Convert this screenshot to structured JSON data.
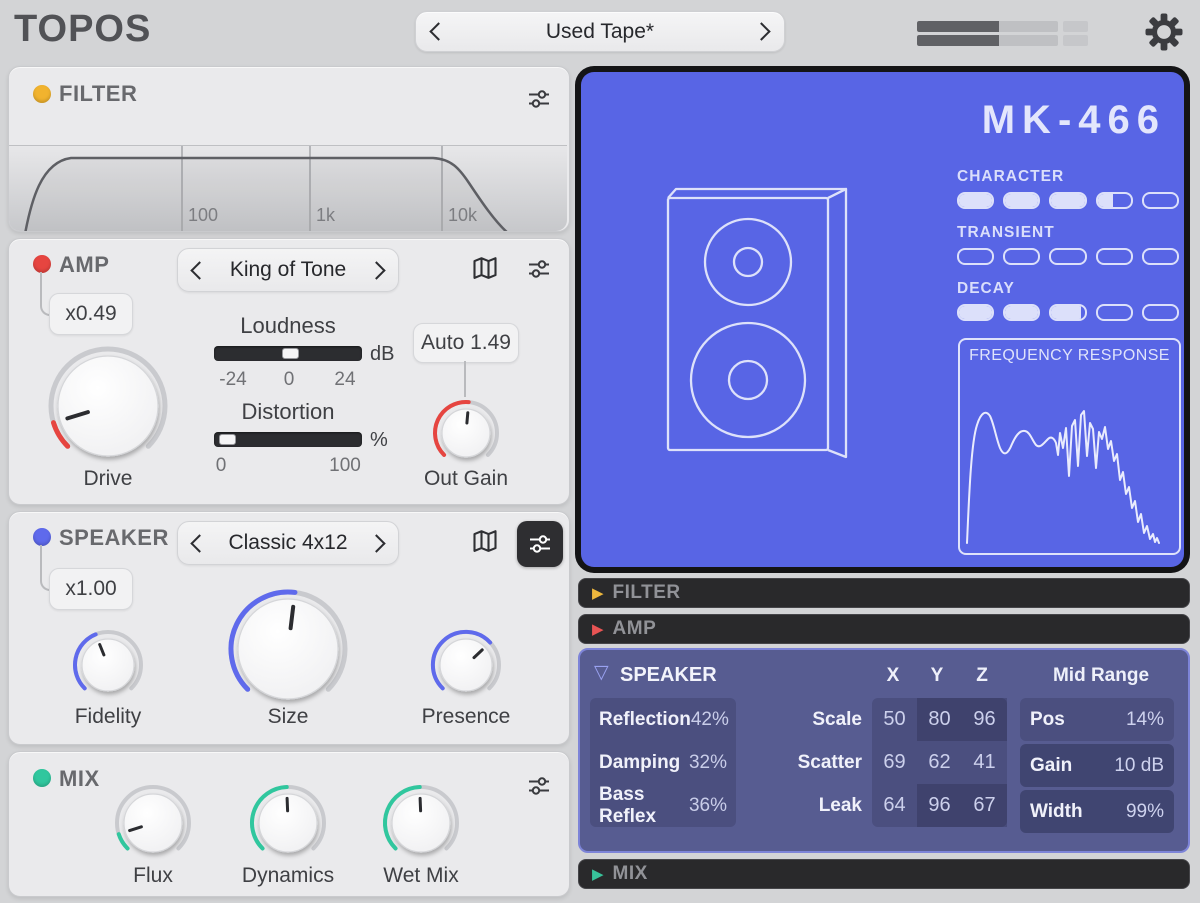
{
  "header": {
    "logo": "TOPOS",
    "preset": {
      "value": "Used Tape*"
    },
    "meter": {
      "fill_pct": 58
    }
  },
  "filter_section": {
    "title": "FILTER",
    "dot_color": "#f1b32e",
    "freq_ticks": [
      "100",
      "1k",
      "10k"
    ]
  },
  "amp_section": {
    "title": "AMP",
    "dot_color": "#e64540",
    "multiplier": "x0.49",
    "preset": "King of Tone",
    "loudness": {
      "label": "Loudness",
      "unit": "dB",
      "scale": [
        "-24",
        "0",
        "24"
      ],
      "handle_pct": 52
    },
    "distortion": {
      "label": "Distortion",
      "unit": "%",
      "scale": [
        "0",
        "100"
      ],
      "handle_pct": 4
    },
    "out_gain_badge": "Auto 1.49",
    "knobs": {
      "drive": {
        "label": "Drive",
        "angle": -107,
        "color": "#e64540"
      },
      "out_gain": {
        "label": "Out Gain",
        "angle": 5,
        "color": "#e64540"
      }
    }
  },
  "speaker_section": {
    "title": "SPEAKER",
    "dot_color": "#5f6aec",
    "multiplier": "x1.00",
    "preset": "Classic 4x12",
    "knobs": {
      "fidelity": {
        "label": "Fidelity",
        "angle": -22,
        "color": "#5f6aec"
      },
      "size": {
        "label": "Size",
        "angle": 7,
        "color": "#5f6aec"
      },
      "presence": {
        "label": "Presence",
        "angle": 47,
        "color": "#5f6aec"
      }
    }
  },
  "mix_section": {
    "title": "MIX",
    "dot_color": "#30c79e",
    "knobs": {
      "flux": {
        "label": "Flux",
        "angle": -108,
        "color": "#30c79e"
      },
      "dynamics": {
        "label": "Dynamics",
        "angle": -2,
        "color": "#30c79e"
      },
      "wet_mix": {
        "label": "Wet Mix",
        "angle": -2,
        "color": "#30c79e"
      }
    }
  },
  "blueprint": {
    "model": "MK-466",
    "params": [
      {
        "label": "CHARACTER",
        "segments": [
          1,
          1,
          1,
          0.45,
          0
        ]
      },
      {
        "label": "TRANSIENT",
        "segments": [
          0,
          0,
          0,
          0,
          0
        ]
      },
      {
        "label": "DECAY",
        "segments": [
          1,
          1,
          0.88,
          0,
          0
        ]
      }
    ],
    "fr_title": "FREQUENCY RESPONSE"
  },
  "panels": {
    "filter": {
      "label": "FILTER",
      "arrow_color": "#edb73d"
    },
    "amp": {
      "label": "AMP",
      "arrow_color": "#e85454"
    },
    "speaker": {
      "label": "SPEAKER",
      "arrow_color": "#9aa2f1",
      "columns": [
        "X",
        "Y",
        "Z"
      ],
      "mid_range_label": "Mid Range",
      "left_rows": [
        {
          "label": "Reflection",
          "value": "42%"
        },
        {
          "label": "Damping",
          "value": "32%"
        },
        {
          "label": "Bass Reflex",
          "value": "36%"
        }
      ],
      "xyz_rows": [
        {
          "label": "Scale",
          "values": [
            50,
            80,
            96
          ]
        },
        {
          "label": "Scatter",
          "values": [
            69,
            62,
            41
          ]
        },
        {
          "label": "Leak",
          "values": [
            64,
            96,
            67
          ]
        }
      ],
      "right_rows": [
        {
          "label": "Pos",
          "value": "14%"
        },
        {
          "label": "Gain",
          "value": "10 dB"
        },
        {
          "label": "Width",
          "value": "99%"
        }
      ]
    },
    "mix": {
      "label": "MIX",
      "arrow_color": "#38c29a"
    }
  }
}
